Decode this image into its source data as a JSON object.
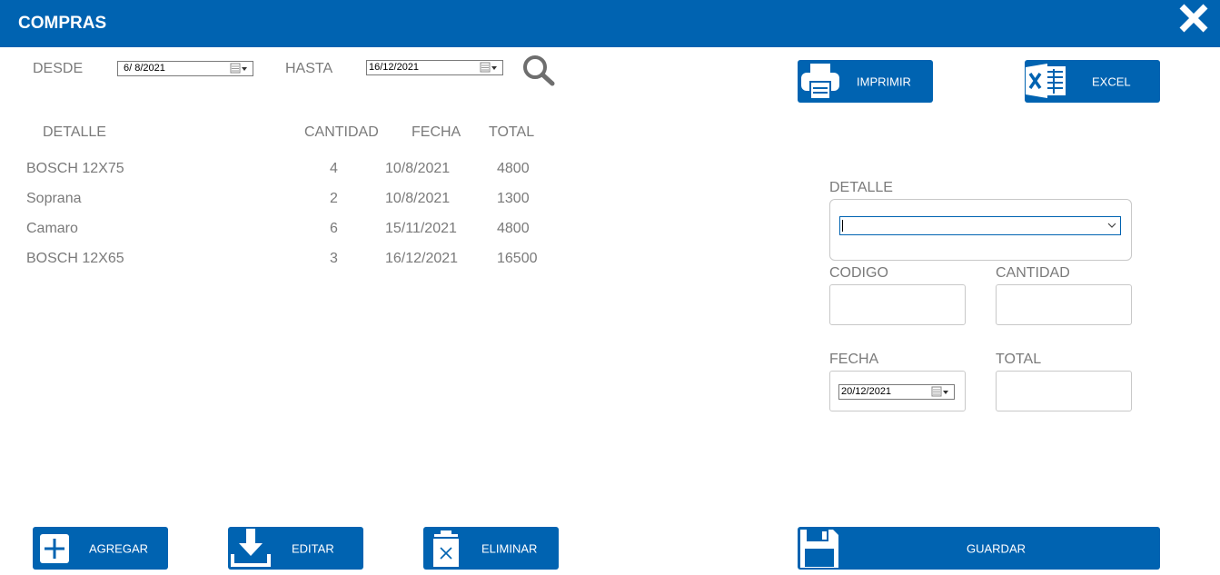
{
  "window": {
    "title": "COMPRAS"
  },
  "filter": {
    "desde_label": "DESDE",
    "desde_value": "6/ 8/2021",
    "hasta_label": "HASTA",
    "hasta_value": "16/12/2021"
  },
  "toolbar": {
    "imprimir_label": "IMPRIMIR",
    "excel_label": "EXCEL"
  },
  "table": {
    "columns": [
      "DETALLE",
      "CANTIDAD",
      "FECHA",
      "TOTAL"
    ],
    "rows": [
      {
        "detalle": "BOSCH 12X75",
        "cantidad": "4",
        "fecha": "10/8/2021",
        "total": "4800"
      },
      {
        "detalle": "Soprana",
        "cantidad": "2",
        "fecha": "10/8/2021",
        "total": "1300"
      },
      {
        "detalle": "Camaro",
        "cantidad": "6",
        "fecha": "15/11/2021",
        "total": "4800"
      },
      {
        "detalle": "BOSCH 12X65",
        "cantidad": "3",
        "fecha": "16/12/2021",
        "total": "16500"
      }
    ]
  },
  "form": {
    "detalle_label": "DETALLE",
    "detalle_value": "",
    "codigo_label": "CODIGO",
    "codigo_value": "",
    "cantidad_label": "CANTIDAD",
    "cantidad_value": "",
    "fecha_label": "FECHA",
    "fecha_value": "20/12/2021",
    "total_label": "TOTAL",
    "total_value": ""
  },
  "actions": {
    "agregar_label": "AGREGAR",
    "editar_label": "EDITAR",
    "eliminar_label": "ELIMINAR",
    "guardar_label": "GUARDAR"
  },
  "colors": {
    "accent": "#0063b1",
    "text": "#7a7a7a"
  },
  "icons": [
    "close-icon",
    "calendar-icon",
    "search-icon",
    "printer-icon",
    "excel-icon",
    "chevron-down-icon",
    "plus-icon",
    "download-icon",
    "trash-icon",
    "floppy-disk-icon"
  ]
}
